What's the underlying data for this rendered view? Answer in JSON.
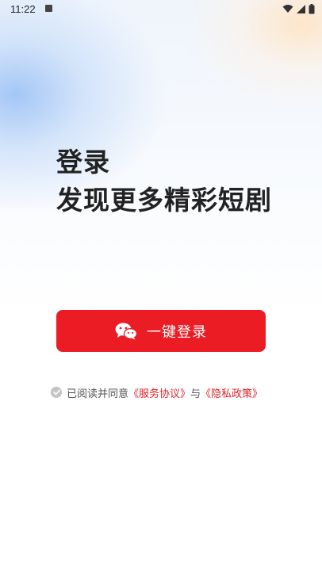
{
  "status_bar": {
    "time": "11:22",
    "icons": [
      "notification-icon",
      "wifi-icon",
      "signal-icon",
      "battery-icon"
    ]
  },
  "headline": {
    "line1": "登录",
    "line2": "发现更多精彩短剧"
  },
  "login_button": {
    "icon": "wechat-icon",
    "label": "一键登录",
    "color": "#ec1c24"
  },
  "agreement": {
    "prefix": "已阅读并同意",
    "service_link": "《服务协议》",
    "connector": "与",
    "privacy_link": "《隐私政策》",
    "link_color": "#e0242a"
  }
}
